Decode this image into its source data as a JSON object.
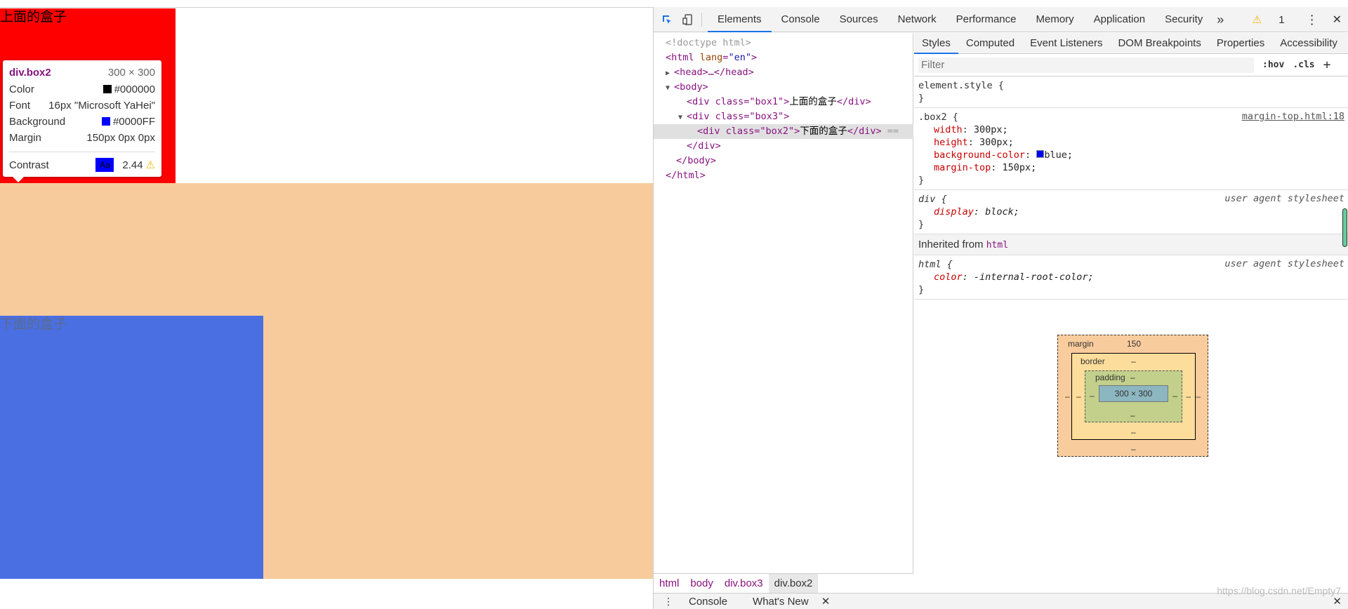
{
  "page": {
    "box1_text": "上面的盒子",
    "box2_text": "下面的盒子"
  },
  "tooltip": {
    "selector_tag": "div",
    "selector_class": ".box2",
    "size": "300 × 300",
    "color_label": "Color",
    "color_value": "#000000",
    "font_label": "Font",
    "font_value": "16px \"Microsoft YaHei\"",
    "background_label": "Background",
    "background_value": "#0000FF",
    "margin_label": "Margin",
    "margin_value": "150px 0px 0px",
    "contrast_label": "Contrast",
    "contrast_sample": "Aa",
    "contrast_value": "2.44"
  },
  "devtools": {
    "tabs": [
      "Elements",
      "Console",
      "Sources",
      "Network",
      "Performance",
      "Memory",
      "Application",
      "Security"
    ],
    "more": "»",
    "warning_count": "1",
    "menu": "⋮",
    "close": "✕"
  },
  "dom": {
    "doctype": "<!doctype html>",
    "html_open_tag": "<html",
    "html_attr": "lang",
    "html_attr_val": "\"en\"",
    "head": "<head>…</head>",
    "body_open": "<body>",
    "div_box1_open": "<div class=\"box1\">",
    "box1_text": "上面的盒子",
    "div_close": "</div>",
    "div_box3_open": "<div class=\"box3\">",
    "div_box2_open": "<div class=\"box2\">",
    "box2_text": "下面的盒子",
    "sel_marker": "==",
    "div3_close": "</div>",
    "body_close": "</body>",
    "html_close": "</html>"
  },
  "breadcrumbs": [
    "html",
    "body",
    "div.box3",
    "div.box2"
  ],
  "styles": {
    "tabs": [
      "Styles",
      "Computed",
      "Event Listeners",
      "DOM Breakpoints",
      "Properties",
      "Accessibility"
    ],
    "filter_placeholder": "Filter",
    "hov": ":hov",
    "cls": ".cls",
    "add": "+",
    "element_style": "element.style {",
    "close_brace": "}",
    "box2_selector": ".box2 {",
    "box2_source": "margin-top.html:18",
    "box2_props": [
      {
        "name": "width",
        "value": "300px;"
      },
      {
        "name": "height",
        "value": "300px;"
      },
      {
        "name": "background-color",
        "value": "blue;"
      },
      {
        "name": "margin-top",
        "value": "150px;"
      }
    ],
    "div_selector": "div {",
    "ua_source": "user agent stylesheet",
    "div_prop": "display",
    "div_val": "block;",
    "inherited_label": "Inherited from",
    "inherited_tag": "html",
    "html_selector": "html {",
    "html_prop": "color",
    "html_val": "-internal-root-color;"
  },
  "box_model": {
    "margin_label": "margin",
    "margin_top": "150",
    "border_label": "border",
    "padding_label": "padding",
    "content": "300 × 300",
    "dash": "–"
  },
  "drawer": {
    "console": "Console",
    "whats_new": "What's New",
    "close_tab": "✕",
    "close": "✕"
  },
  "watermark": "https://blog.csdn.net/Empty7"
}
